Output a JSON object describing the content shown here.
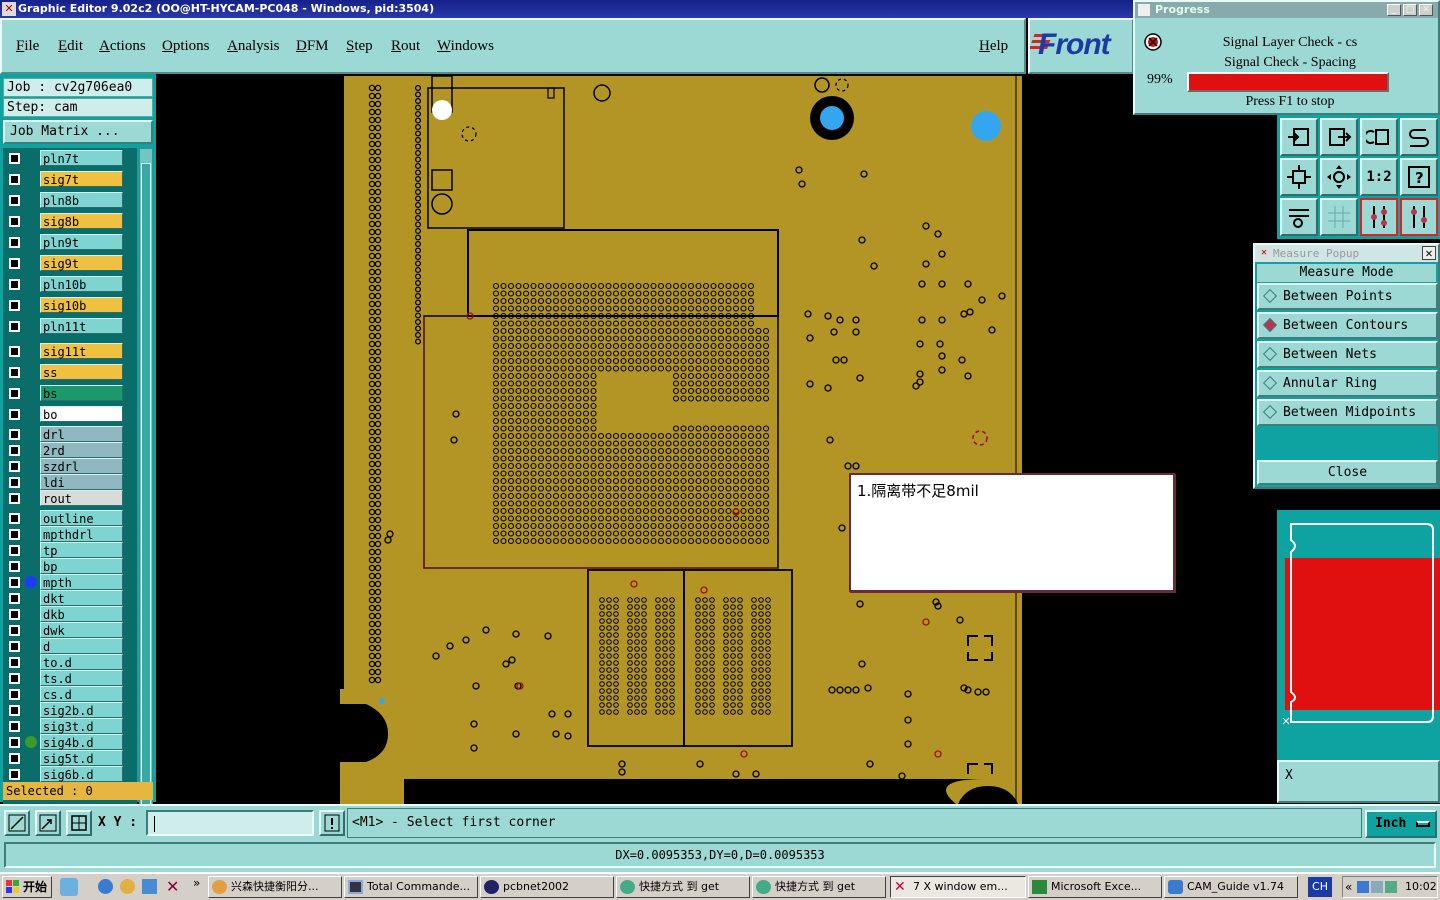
{
  "window": {
    "title": "Graphic Editor 9.02c2 (OO@HT-HYCAM-PC048 - Windows, pid:3504)"
  },
  "menu": [
    "File",
    "Edit",
    "Actions",
    "Options",
    "Analysis",
    "DFM",
    "Step",
    "Rout",
    "Windows"
  ],
  "help_label": "Help",
  "logo_text": "Front",
  "job": {
    "job_label": "Job : cv2g706ea0",
    "step_label": "Step: cam",
    "matrix_button": "Job Matrix ..."
  },
  "layers": [
    {
      "name": "pln7t",
      "color": "#7ed4d0",
      "dot": ""
    },
    {
      "name": "sig7t",
      "color": "#f0c040",
      "dot": ""
    },
    {
      "name": "pln8b",
      "color": "#7ed4d0",
      "dot": ""
    },
    {
      "name": "sig8b",
      "color": "#f0c040",
      "dot": ""
    },
    {
      "name": "pln9t",
      "color": "#7ed4d0",
      "dot": ""
    },
    {
      "name": "sig9t",
      "color": "#f0c040",
      "dot": ""
    },
    {
      "name": "pln10b",
      "color": "#7ed4d0",
      "dot": ""
    },
    {
      "name": "sig10b",
      "color": "#f0c040",
      "dot": ""
    },
    {
      "name": "pln11t",
      "color": "#7ed4d0",
      "dot": ""
    },
    {
      "name": "sig11t",
      "color": "#f0c040",
      "dot": ""
    },
    {
      "name": "ss",
      "color": "#f0c040",
      "dot": ""
    },
    {
      "name": "bs",
      "color": "#1a9a6a",
      "dot": ""
    },
    {
      "name": "bo",
      "color": "#ffffff",
      "dot": ""
    },
    {
      "name": "drl",
      "color": "#90b8c0",
      "dot": ""
    },
    {
      "name": "2rd",
      "color": "#90b8c0",
      "dot": ""
    },
    {
      "name": "szdrl",
      "color": "#90b8c0",
      "dot": ""
    },
    {
      "name": "ldi",
      "color": "#90b8c0",
      "dot": ""
    },
    {
      "name": "rout",
      "color": "#d8dcd8",
      "dot": ""
    },
    {
      "name": "outline",
      "color": "#7ed4d0",
      "dot": ""
    },
    {
      "name": "mpthdrl",
      "color": "#7ed4d0",
      "dot": ""
    },
    {
      "name": "tp",
      "color": "#7ed4d0",
      "dot": ""
    },
    {
      "name": "bp",
      "color": "#7ed4d0",
      "dot": ""
    },
    {
      "name": "mpth",
      "color": "#7ed4d0",
      "dot": "#1a3aff"
    },
    {
      "name": "dkt",
      "color": "#7ed4d0",
      "dot": ""
    },
    {
      "name": "dkb",
      "color": "#7ed4d0",
      "dot": ""
    },
    {
      "name": "dwk",
      "color": "#7ed4d0",
      "dot": ""
    },
    {
      "name": "d",
      "color": "#7ed4d0",
      "dot": ""
    },
    {
      "name": "to.d",
      "color": "#7ed4d0",
      "dot": ""
    },
    {
      "name": "ts.d",
      "color": "#7ed4d0",
      "dot": ""
    },
    {
      "name": "cs.d",
      "color": "#7ed4d0",
      "dot": ""
    },
    {
      "name": "sig2b.d",
      "color": "#7ed4d0",
      "dot": ""
    },
    {
      "name": "sig3t.d",
      "color": "#7ed4d0",
      "dot": ""
    },
    {
      "name": "sig4b.d",
      "color": "#7ed4d0",
      "dot": "#3a9a2a"
    },
    {
      "name": "sig5t.d",
      "color": "#7ed4d0",
      "dot": ""
    },
    {
      "name": "sig6b.d",
      "color": "#7ed4d0",
      "dot": ""
    }
  ],
  "selected_label": "Selected : 0",
  "progress": {
    "title": "Progress",
    "line1": "Signal Layer Check - cs",
    "line2": "Signal Check - Spacing",
    "percent": "99%",
    "percent_value": 99,
    "stop_hint": "Press F1 to stop"
  },
  "measure": {
    "title": "Measure Popup",
    "mode_label": "Measure Mode",
    "options": [
      {
        "label": "Between Points",
        "selected": false
      },
      {
        "label": "Between Contours",
        "selected": true
      },
      {
        "label": "Between Nets",
        "selected": false
      },
      {
        "label": "Annular Ring",
        "selected": false
      },
      {
        "label": "Between Midpoints",
        "selected": false
      }
    ],
    "close_label": "Close"
  },
  "x_panel_label": "X",
  "note_text": "1.隔离带不足8mil",
  "command": {
    "xy_label": "X Y :",
    "xy_value": "",
    "prompt": "<M1> - Select first corner",
    "unit": "Inch"
  },
  "status": "DX=0.0095353,DY=0,D=0.0095353",
  "taskbar": {
    "start": "开始",
    "items": [
      {
        "label": "兴森快捷衡阳分...",
        "active": false
      },
      {
        "label": "Total Commande...",
        "active": false
      },
      {
        "label": "pcbnet2002",
        "active": false
      },
      {
        "label": "快捷方式 到 get",
        "active": false
      },
      {
        "label": "快捷方式 到 get",
        "active": false
      },
      {
        "label": "7 X window em...",
        "active": true
      },
      {
        "label": "Microsoft Exce...",
        "active": false
      },
      {
        "label": "CAM_Guide v1.74",
        "active": false
      }
    ],
    "lang": "CH",
    "clock": "10:02"
  },
  "colors": {
    "board": "#b39525",
    "panel": "#9cd8d4",
    "accent_teal": "#0ea3a0",
    "progress_fill": "#e01010"
  }
}
